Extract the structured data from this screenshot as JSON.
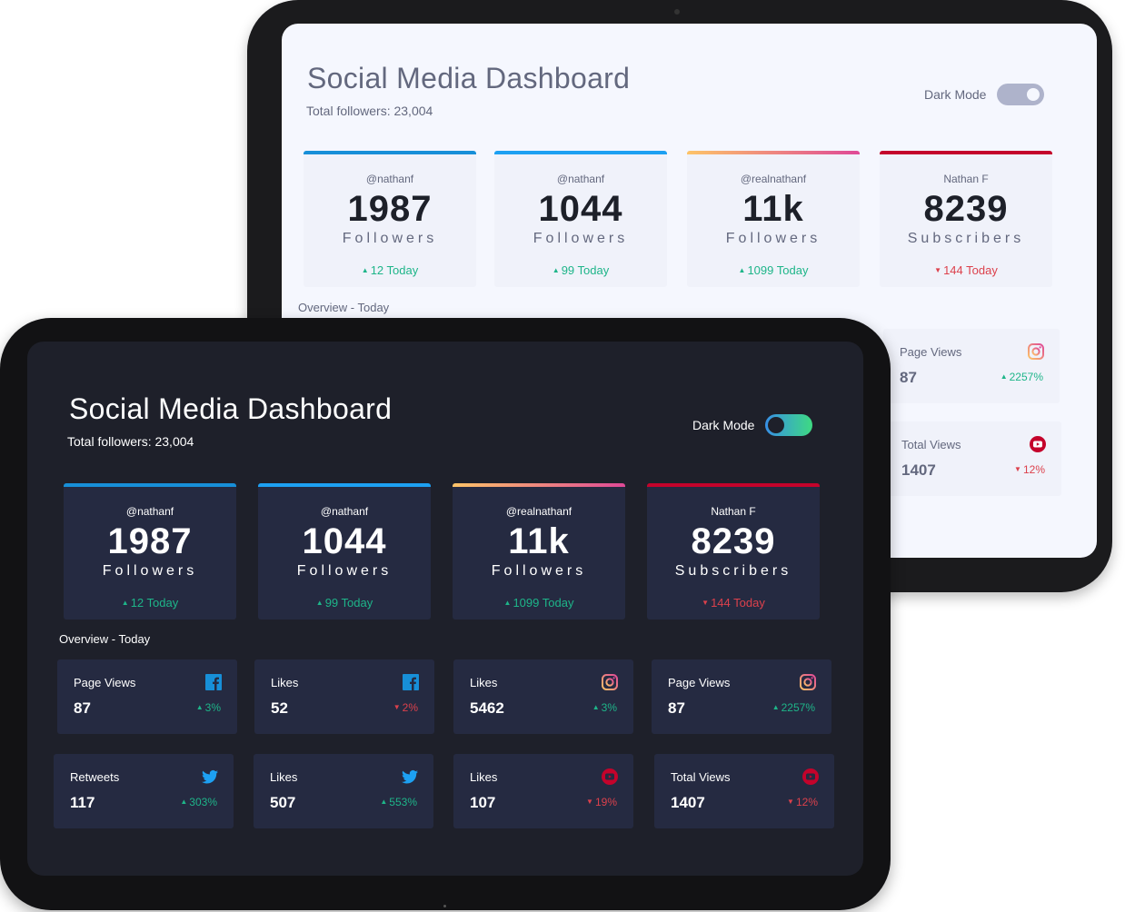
{
  "colors": {
    "facebook": "#178fd8",
    "twitter": "#1da0f2",
    "instagram_start": "#fdc468",
    "instagram_end": "#df4996",
    "youtube": "#c4032b",
    "up": "#1eb589",
    "down": "#dc414c",
    "toggle_dark_start": "#378fe6",
    "toggle_dark_end": "#3eda82",
    "toggle_light": "#aeb3cb"
  },
  "light": {
    "title": "Social Media Dashboard",
    "subtitle": "Total followers: 23,004",
    "toggle_label": "Dark Mode",
    "cards": [
      {
        "handle": "@nathanf",
        "count": "1987",
        "label": "Followers",
        "change": "12 Today",
        "direction": "up"
      },
      {
        "handle": "@nathanf",
        "count": "1044",
        "label": "Followers",
        "change": "99 Today",
        "direction": "up"
      },
      {
        "handle": "@realnathanf",
        "count": "11k",
        "label": "Followers",
        "change": "1099 Today",
        "direction": "up"
      },
      {
        "handle": "Nathan F",
        "count": "8239",
        "label": "Subscribers",
        "change": "144 Today",
        "direction": "down"
      }
    ],
    "overview_title": "Overview - Today",
    "overview": [
      {
        "label": "Page Views",
        "value": "87",
        "change": "2257%",
        "direction": "up",
        "icon": "instagram-icon"
      },
      {
        "label": "Total Views",
        "value": "1407",
        "change": "12%",
        "direction": "down",
        "icon": "youtube-icon"
      }
    ]
  },
  "dark": {
    "title": "Social Media Dashboard",
    "subtitle": "Total followers: 23,004",
    "toggle_label": "Dark Mode",
    "cards": [
      {
        "handle": "@nathanf",
        "count": "1987",
        "label": "Followers",
        "change": "12 Today",
        "direction": "up"
      },
      {
        "handle": "@nathanf",
        "count": "1044",
        "label": "Followers",
        "change": "99 Today",
        "direction": "up"
      },
      {
        "handle": "@realnathanf",
        "count": "11k",
        "label": "Followers",
        "change": "1099 Today",
        "direction": "up"
      },
      {
        "handle": "Nathan F",
        "count": "8239",
        "label": "Subscribers",
        "change": "144 Today",
        "direction": "down"
      }
    ],
    "overview_title": "Overview - Today",
    "overview": [
      {
        "label": "Page Views",
        "value": "87",
        "change": "3%",
        "direction": "up",
        "icon": "facebook-icon"
      },
      {
        "label": "Likes",
        "value": "52",
        "change": "2%",
        "direction": "down",
        "icon": "facebook-icon"
      },
      {
        "label": "Likes",
        "value": "5462",
        "change": "3%",
        "direction": "up",
        "icon": "instagram-icon"
      },
      {
        "label": "Page Views",
        "value": "87",
        "change": "2257%",
        "direction": "up",
        "icon": "instagram-icon"
      },
      {
        "label": "Retweets",
        "value": "117",
        "change": "303%",
        "direction": "up",
        "icon": "twitter-icon"
      },
      {
        "label": "Likes",
        "value": "507",
        "change": "553%",
        "direction": "up",
        "icon": "twitter-icon"
      },
      {
        "label": "Likes",
        "value": "107",
        "change": "19%",
        "direction": "down",
        "icon": "youtube-icon"
      },
      {
        "label": "Total Views",
        "value": "1407",
        "change": "12%",
        "direction": "down",
        "icon": "youtube-icon"
      }
    ]
  }
}
